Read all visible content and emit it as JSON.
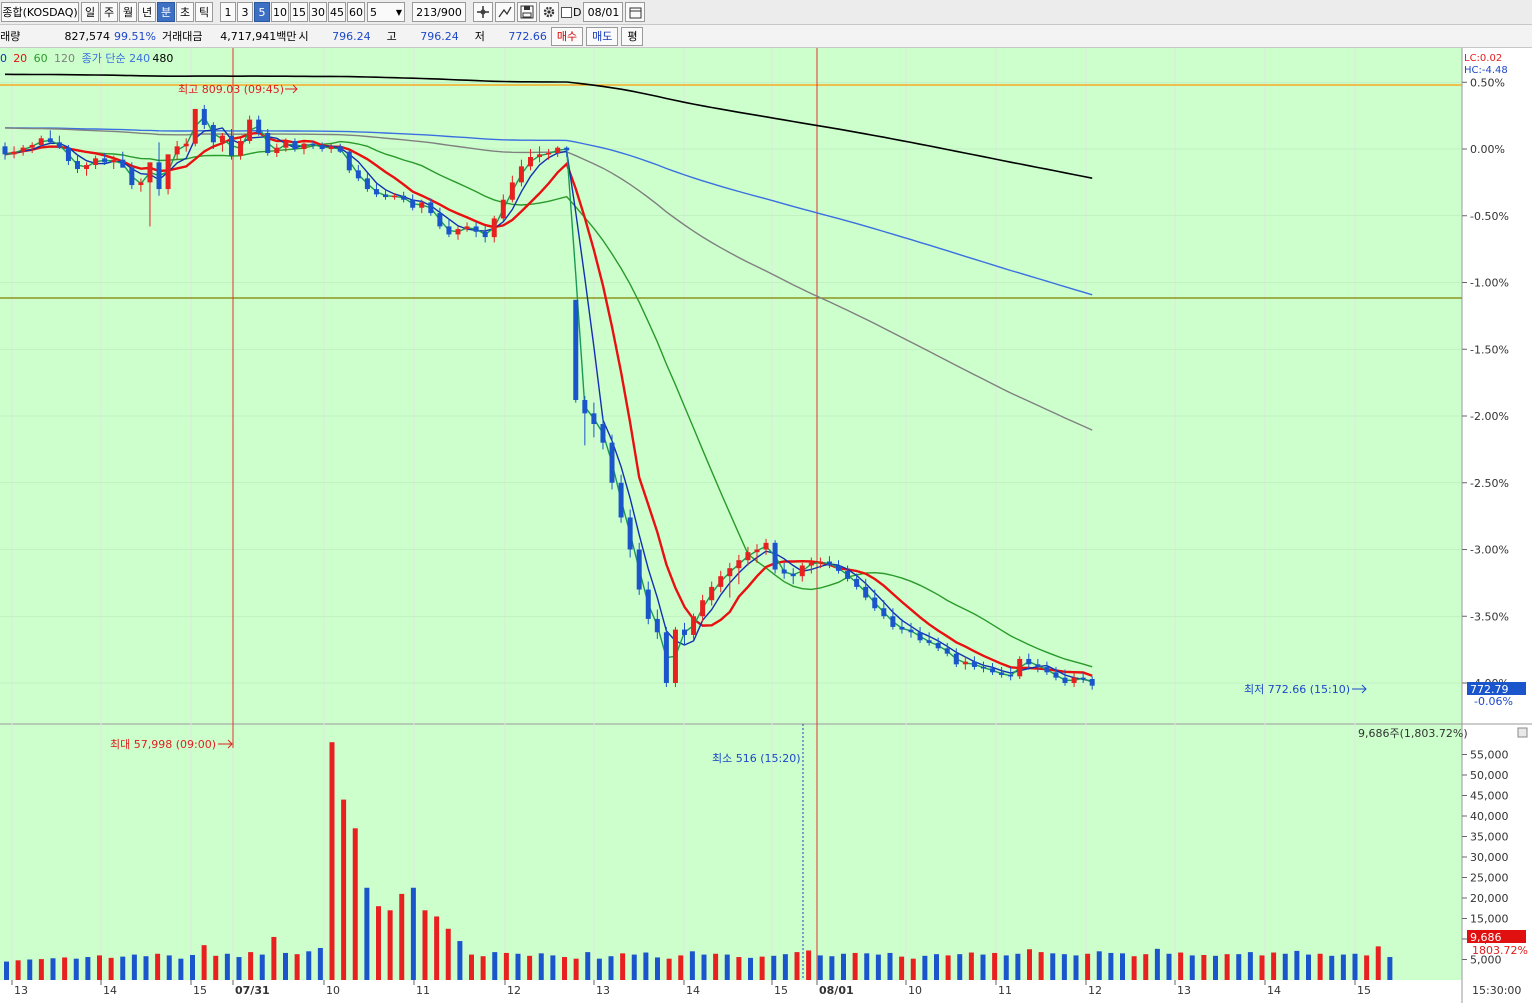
{
  "toolbar": {
    "symbol": "종합(KOSDAQ)",
    "periods": [
      "일",
      "주",
      "월",
      "년",
      "분",
      "초",
      "틱"
    ],
    "selected_period": "분",
    "intervals": [
      "1",
      "3",
      "5",
      "10",
      "15",
      "30",
      "45",
      "60"
    ],
    "selected_interval": "5",
    "interval_input": "5",
    "bar_count": "213/900",
    "date_checkbox_label": "D",
    "date": "08/01"
  },
  "quote": {
    "volume_label": "거래량",
    "volume": "827,574",
    "volume_pct": "99.51%",
    "value_label": "거래대금",
    "value": "4,717,941백만",
    "open_label": "시",
    "open": "796.24",
    "high_label": "고",
    "high": "796.24",
    "low_label": "저",
    "low": "772.66",
    "buy_button": "매수",
    "sell_button": "매도",
    "eval_button": "평"
  },
  "colors": {
    "background": "#ccffcc",
    "up": "#e82020",
    "down": "#1a55cc",
    "ma5": "#1a9a55",
    "ma10": "#1230b0",
    "ma20": "#e81010",
    "ma60": "#2a9a2a",
    "ma120": "#808080",
    "ma240": "#3b6fe0",
    "ma480": "#000000",
    "hline_orange": "#ff9900",
    "hline_olive": "#808000"
  },
  "chart_data": {
    "type": "candlestick",
    "legend": [
      {
        "text": "0",
        "color": "#1230b0"
      },
      {
        "text": "20",
        "color": "#e81010"
      },
      {
        "text": "60",
        "color": "#2a9a2a"
      },
      {
        "text": "120",
        "color": "#808080"
      },
      {
        "text": "종가 단순 240",
        "color": "#3b6fe0"
      },
      {
        "text": "480",
        "color": "#000000"
      }
    ],
    "corner_labels": [
      "LC:0.02",
      "HC:-4.48"
    ],
    "price_axis_ticks": [
      "0.50%",
      "0.00%",
      "-0.50%",
      "-1.00%",
      "-1.50%",
      "-2.00%",
      "-2.50%",
      "-3.00%",
      "-3.50%",
      "-4.00%"
    ],
    "price_axis_values": [
      0.5,
      0.0,
      -0.5,
      -1.0,
      -1.5,
      -2.0,
      -2.5,
      -3.0,
      -3.5,
      -4.0
    ],
    "last_price_tag": "772.79",
    "last_pct_tag": "-0.06%",
    "high_annotation": "최고 809.03 (09:45)",
    "low_annotation": "최저 772.66 (15:10)",
    "x_axis_labels": [
      "13",
      "14",
      "15",
      "07/31",
      "10",
      "11",
      "12",
      "13",
      "14",
      "15",
      "08/01",
      "10",
      "11",
      "12",
      "13",
      "14",
      "15"
    ],
    "time_label": "15:30:00",
    "candles_pct": [
      [
        0.02,
        0.05,
        -0.08,
        -0.04
      ],
      [
        -0.04,
        0.02,
        -0.07,
        -0.02
      ],
      [
        -0.02,
        0.03,
        -0.05,
        0.01
      ],
      [
        0.01,
        0.05,
        -0.03,
        0.03
      ],
      [
        0.03,
        0.1,
        0.01,
        0.08
      ],
      [
        0.08,
        0.14,
        0.04,
        0.05
      ],
      [
        0.05,
        0.1,
        0.0,
        0.01
      ],
      [
        0.01,
        0.03,
        -0.12,
        -0.09
      ],
      [
        -0.09,
        -0.04,
        -0.18,
        -0.15
      ],
      [
        -0.15,
        -0.1,
        -0.2,
        -0.12
      ],
      [
        -0.12,
        -0.05,
        -0.15,
        -0.07
      ],
      [
        -0.07,
        -0.03,
        -0.12,
        -0.1
      ],
      [
        -0.1,
        -0.05,
        -0.15,
        -0.08
      ],
      [
        -0.08,
        -0.02,
        -0.12,
        -0.14
      ],
      [
        -0.14,
        -0.1,
        -0.3,
        -0.27
      ],
      [
        -0.27,
        -0.22,
        -0.32,
        -0.25
      ],
      [
        -0.25,
        -0.12,
        -0.58,
        -0.1
      ],
      [
        -0.1,
        0.05,
        -0.35,
        -0.3
      ],
      [
        -0.3,
        -0.05,
        -0.34,
        -0.04
      ],
      [
        -0.04,
        0.06,
        -0.08,
        0.02
      ],
      [
        0.02,
        0.08,
        -0.02,
        0.04
      ],
      [
        0.04,
        0.3,
        0.02,
        0.3
      ],
      [
        0.3,
        0.33,
        0.15,
        0.18
      ],
      [
        0.18,
        0.2,
        0.0,
        0.05
      ],
      [
        0.05,
        0.12,
        -0.02,
        0.1
      ],
      [
        0.1,
        0.15,
        -0.08,
        -0.05
      ],
      [
        -0.05,
        0.08,
        -0.08,
        0.06
      ],
      [
        0.06,
        0.25,
        0.04,
        0.22
      ],
      [
        0.22,
        0.25,
        0.1,
        0.12
      ],
      [
        0.12,
        0.15,
        -0.05,
        -0.03
      ],
      [
        -0.03,
        0.04,
        -0.06,
        0.01
      ],
      [
        0.01,
        0.08,
        -0.02,
        0.06
      ],
      [
        0.06,
        0.08,
        -0.02,
        0.0
      ],
      [
        0.0,
        0.06,
        -0.04,
        0.04
      ],
      [
        0.04,
        0.06,
        0.0,
        0.03
      ],
      [
        0.03,
        0.05,
        -0.02,
        0.0
      ],
      [
        0.0,
        0.04,
        -0.03,
        0.02
      ],
      [
        0.02,
        0.04,
        -0.03,
        -0.02
      ],
      [
        -0.02,
        0.0,
        -0.18,
        -0.16
      ],
      [
        -0.16,
        -0.12,
        -0.24,
        -0.22
      ],
      [
        -0.22,
        -0.18,
        -0.32,
        -0.3
      ],
      [
        -0.3,
        -0.26,
        -0.36,
        -0.34
      ],
      [
        -0.34,
        -0.3,
        -0.38,
        -0.36
      ],
      [
        -0.36,
        -0.33,
        -0.38,
        -0.35
      ],
      [
        -0.35,
        -0.32,
        -0.4,
        -0.38
      ],
      [
        -0.38,
        -0.34,
        -0.46,
        -0.44
      ],
      [
        -0.44,
        -0.38,
        -0.48,
        -0.4
      ],
      [
        -0.4,
        -0.37,
        -0.5,
        -0.48
      ],
      [
        -0.48,
        -0.44,
        -0.6,
        -0.58
      ],
      [
        -0.58,
        -0.52,
        -0.66,
        -0.64
      ],
      [
        -0.64,
        -0.58,
        -0.68,
        -0.6
      ],
      [
        -0.6,
        -0.55,
        -0.62,
        -0.58
      ],
      [
        -0.58,
        -0.55,
        -0.66,
        -0.62
      ],
      [
        -0.62,
        -0.58,
        -0.7,
        -0.66
      ],
      [
        -0.66,
        -0.5,
        -0.7,
        -0.52
      ],
      [
        -0.52,
        -0.34,
        -0.54,
        -0.38
      ],
      [
        -0.38,
        -0.2,
        -0.4,
        -0.25
      ],
      [
        -0.25,
        -0.08,
        -0.28,
        -0.13
      ],
      [
        -0.13,
        0.0,
        -0.16,
        -0.06
      ],
      [
        -0.06,
        0.02,
        -0.1,
        -0.04
      ],
      [
        -0.04,
        0.0,
        -0.08,
        -0.03
      ],
      [
        -0.03,
        0.02,
        -0.06,
        0.01
      ],
      [
        0.01,
        0.02,
        -0.06,
        -0.01
      ],
      [
        -1.13,
        -1.13,
        -1.9,
        -1.88
      ],
      [
        -1.88,
        -1.85,
        -2.22,
        -1.98
      ],
      [
        -1.98,
        -1.9,
        -2.16,
        -2.06
      ],
      [
        -2.06,
        -2.0,
        -2.25,
        -2.2
      ],
      [
        -2.2,
        -2.14,
        -2.55,
        -2.5
      ],
      [
        -2.5,
        -2.44,
        -2.8,
        -2.76
      ],
      [
        -2.76,
        -2.7,
        -3.06,
        -3.0
      ],
      [
        -3.0,
        -2.95,
        -3.34,
        -3.3
      ],
      [
        -3.3,
        -3.24,
        -3.56,
        -3.52
      ],
      [
        -3.52,
        -3.45,
        -3.67,
        -3.62
      ],
      [
        -3.62,
        -3.58,
        -4.03,
        -4.0
      ],
      [
        -4.0,
        -3.58,
        -4.03,
        -3.6
      ],
      [
        -3.6,
        -3.55,
        -3.72,
        -3.64
      ],
      [
        -3.64,
        -3.48,
        -3.68,
        -3.5
      ],
      [
        -3.5,
        -3.34,
        -3.54,
        -3.38
      ],
      [
        -3.38,
        -3.24,
        -3.42,
        -3.28
      ],
      [
        -3.28,
        -3.16,
        -3.32,
        -3.2
      ],
      [
        -3.2,
        -3.1,
        -3.36,
        -3.14
      ],
      [
        -3.14,
        -3.04,
        -3.26,
        -3.08
      ],
      [
        -3.08,
        -2.98,
        -3.12,
        -3.02
      ],
      [
        -3.02,
        -2.96,
        -3.1,
        -3.0
      ],
      [
        -3.0,
        -2.92,
        -3.04,
        -2.95
      ],
      [
        -2.95,
        -2.93,
        -3.18,
        -3.15
      ],
      [
        -3.15,
        -3.1,
        -3.22,
        -3.18
      ],
      [
        -3.18,
        -3.14,
        -3.26,
        -3.2
      ],
      [
        -3.2,
        -3.1,
        -3.24,
        -3.12
      ],
      [
        -3.12,
        -3.06,
        -3.18,
        -3.1
      ],
      [
        -3.1,
        -3.06,
        -3.14,
        -3.09
      ],
      [
        -3.09,
        -3.05,
        -3.14,
        -3.12
      ],
      [
        -3.12,
        -3.08,
        -3.18,
        -3.16
      ],
      [
        -3.16,
        -3.12,
        -3.24,
        -3.22
      ],
      [
        -3.22,
        -3.18,
        -3.3,
        -3.28
      ],
      [
        -3.28,
        -3.22,
        -3.38,
        -3.36
      ],
      [
        -3.36,
        -3.3,
        -3.46,
        -3.44
      ],
      [
        -3.44,
        -3.38,
        -3.52,
        -3.5
      ],
      [
        -3.5,
        -3.44,
        -3.6,
        -3.58
      ],
      [
        -3.58,
        -3.52,
        -3.63,
        -3.6
      ],
      [
        -3.6,
        -3.55,
        -3.66,
        -3.62
      ],
      [
        -3.62,
        -3.58,
        -3.7,
        -3.68
      ],
      [
        -3.68,
        -3.62,
        -3.72,
        -3.7
      ],
      [
        -3.7,
        -3.66,
        -3.76,
        -3.74
      ],
      [
        -3.74,
        -3.7,
        -3.8,
        -3.78
      ],
      [
        -3.78,
        -3.74,
        -3.88,
        -3.86
      ],
      [
        -3.86,
        -3.8,
        -3.9,
        -3.84
      ],
      [
        -3.84,
        -3.8,
        -3.9,
        -3.88
      ],
      [
        -3.88,
        -3.84,
        -3.92,
        -3.89
      ],
      [
        -3.89,
        -3.85,
        -3.94,
        -3.92
      ],
      [
        -3.92,
        -3.88,
        -3.96,
        -3.94
      ],
      [
        -3.94,
        -3.88,
        -3.98,
        -3.95
      ],
      [
        -3.95,
        -3.8,
        -3.97,
        -3.82
      ],
      [
        -3.82,
        -3.78,
        -3.9,
        -3.86
      ],
      [
        -3.86,
        -3.82,
        -3.92,
        -3.88
      ],
      [
        -3.88,
        -3.84,
        -3.94,
        -3.92
      ],
      [
        -3.92,
        -3.88,
        -3.98,
        -3.96
      ],
      [
        -3.96,
        -3.9,
        -4.02,
        -4.0
      ],
      [
        -4.0,
        -3.92,
        -4.03,
        -3.96
      ],
      [
        -3.96,
        -3.92,
        -4.0,
        -3.97
      ],
      [
        -3.97,
        -3.95,
        -4.05,
        -4.02
      ]
    ],
    "volume_values": [
      4.5,
      4.8,
      5.0,
      5.1,
      5.3,
      5.5,
      5.2,
      5.6,
      6.0,
      5.4,
      5.7,
      6.2,
      5.8,
      6.4,
      6.0,
      5.2,
      6.1,
      8.5,
      5.9,
      6.4,
      5.6,
      6.8,
      6.2,
      10.5,
      6.6,
      6.3,
      7.0,
      7.8,
      58.0,
      44.0,
      37.0,
      22.5,
      18.0,
      17.0,
      21.0,
      22.5,
      17.0,
      15.5,
      12.5,
      9.5,
      6.2,
      5.8,
      6.8,
      6.6,
      6.4,
      5.9,
      6.5,
      6.0,
      5.6,
      5.2,
      6.8,
      5.2,
      5.8,
      6.5,
      6.2,
      6.7,
      5.5,
      5.2,
      6.0,
      7.0,
      6.2,
      6.4,
      6.2,
      5.6,
      5.4,
      5.7,
      5.9,
      6.3,
      6.8,
      7.2,
      6.0,
      5.8,
      6.4,
      6.6,
      6.5,
      6.2,
      6.6,
      5.7,
      5.2,
      5.9,
      6.3,
      6.0,
      6.3,
      6.7,
      6.2,
      6.6,
      6.0,
      6.4,
      7.5,
      6.8,
      6.5,
      6.3,
      6.0,
      6.4,
      7.0,
      6.6,
      6.5,
      5.8,
      6.3,
      7.6,
      6.4,
      6.7,
      6.0,
      6.1,
      5.9,
      6.3,
      6.3,
      6.8,
      6.0,
      6.7,
      6.4,
      7.1,
      6.2,
      6.4,
      5.9,
      6.2,
      6.4,
      6.0,
      8.2,
      5.6
    ],
    "volume_ticks": [
      "55,000",
      "50,000",
      "45,000",
      "40,000",
      "35,000",
      "30,000",
      "25,000",
      "20,000",
      "15,000",
      "10,000",
      "5,000"
    ],
    "volume_tick_values": [
      55,
      50,
      45,
      40,
      35,
      30,
      25,
      20,
      15,
      10,
      5
    ],
    "max_volume_annotation": "최대 57,998 (09:00)",
    "min_volume_annotation": "최소 516 (15:20)",
    "volume_summary": "9,686주(1,803.72%)",
    "volume_tag": "9,686",
    "volume_tag_pct": "1803.72%"
  }
}
